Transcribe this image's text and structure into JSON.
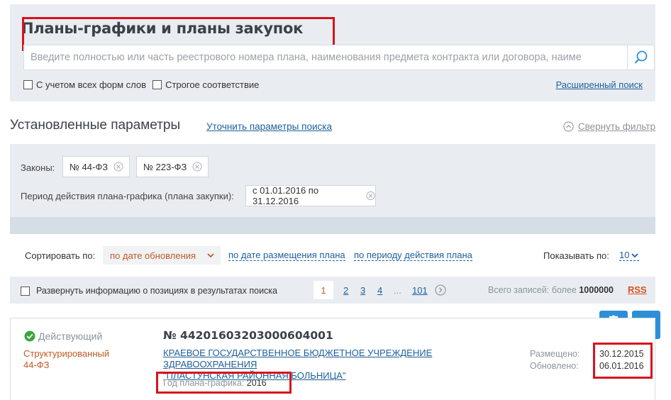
{
  "search": {
    "title": "Планы-графики и планы закупок",
    "placeholder": "Введите полностью или часть реестрового номера плана, наименования предмета контракта или договора, наиме",
    "checkbox_all_forms": "С учетом всех форм слов",
    "checkbox_strict": "Строгое соответствие",
    "advanced_link": "Расширенный поиск"
  },
  "params": {
    "title": "Установленные параметры",
    "refine_link": "Уточнить параметры поиска",
    "collapse_link": "Свернуть фильтр",
    "laws_label": "Законы:",
    "laws": [
      "№ 44-ФЗ",
      "№ 223-ФЗ"
    ],
    "period_label": "Период действия плана-графика (плана закупки):",
    "period_value": "с 01.01.2016 по 31.12.2016"
  },
  "sort": {
    "label": "Сортировать по:",
    "active": "по дате обновления",
    "options": [
      "по дате размещения плана",
      "по периоду действия плана"
    ],
    "show_label": "Показывать по:",
    "show_value": "10"
  },
  "pager": {
    "expand_label": "Развернуть информацию о позициях в результатах поиска",
    "pages": [
      "1",
      "2",
      "3",
      "4",
      "...",
      "101"
    ],
    "total_label": "Всего записей: более",
    "total_value": "1000000",
    "rss": "RSS"
  },
  "result": {
    "status": "Действующий",
    "type_line1": "Структурированный",
    "type_line2": "44-ФЗ",
    "number": "№ 44201603203000604001",
    "org_line1": "КРАЕВОЕ ГОСУДАРСТВЕННОЕ БЮДЖЕТНОЕ УЧРЕЖДЕНИЕ ЗДРАВООХРАНЕНИЯ",
    "org_line2": "\"ПЛАСТУНСКАЯ РАЙОННАЯ БОЛЬНИЦА\"",
    "year_label": "Год плана-графика:",
    "year_value": "2016",
    "placed_label": "Размещено:",
    "placed_value": "30.12.2015",
    "updated_label": "Обновлено:",
    "updated_value": "06.01.2016"
  },
  "colors": {
    "accent_blue": "#2e8fd6",
    "link_blue": "#1d5f9c",
    "highlight_red": "#d8121d",
    "orange": "#c25a25",
    "status_green": "#3aa63a",
    "panel_gray": "#e9edf1"
  },
  "icons": {
    "search": "search-icon",
    "collapse": "chevron-up-circle-icon",
    "remove": "close-circle-icon",
    "sort_dropdown": "chevron-down-icon",
    "next_page": "chevron-right-circle-icon",
    "status": "check-circle-icon",
    "certificate": "award-icon",
    "print": "print-icon"
  }
}
